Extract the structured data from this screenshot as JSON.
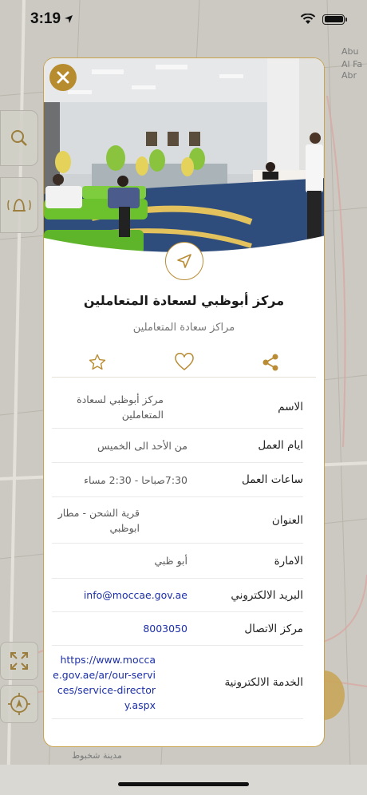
{
  "status_bar": {
    "time": "3:19"
  },
  "map": {
    "labels": [
      "Abu",
      "Al Fa",
      "Abr",
      "مدينة شخبوط"
    ]
  },
  "card": {
    "title": "مركز أبوظبي لسعادة المتعاملين",
    "subtitle": "مراكز سعادة المتعاملين",
    "details": [
      {
        "label": "الاسم",
        "value": "مركز أبوظبي لسعادة المتعاملين"
      },
      {
        "label": "ايام العمل",
        "value": "من الأحد الى الخميس"
      },
      {
        "label": "ساعات العمل",
        "value": "7:30صباحا - 2:30 مساء"
      },
      {
        "label": "العنوان",
        "value": "قرية الشحن - مطار ابوظبي"
      },
      {
        "label": "الامارة",
        "value": "أبو ظبي"
      },
      {
        "label": "البريد الالكتروني",
        "value": "info@moccae.gov.ae"
      },
      {
        "label": "مركز الاتصال",
        "value": "8003050"
      },
      {
        "label": "الخدمة الالكترونية",
        "value": "https://www.moccae.gov.ae/ar/our-services/service-directory.aspx"
      }
    ]
  },
  "colors": {
    "accent": "#b98c35",
    "link": "#1c2fa8"
  },
  "icons": [
    "close-icon",
    "navigate-icon",
    "star-icon",
    "heart-icon",
    "share-icon",
    "search-icon",
    "bell-icon",
    "expand-icon",
    "locate-icon",
    "wifi-icon",
    "battery-icon"
  ]
}
